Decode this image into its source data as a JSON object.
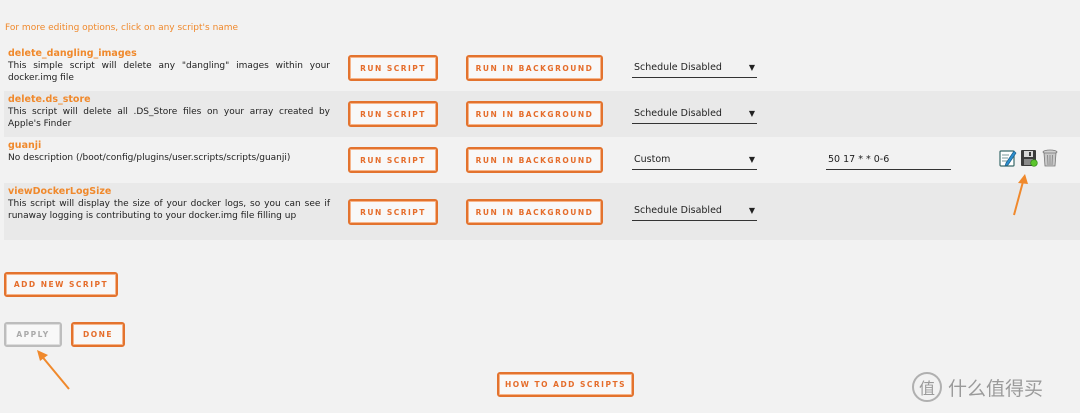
{
  "hint": "For more editing options, click on any script's name",
  "scripts": [
    {
      "name": "delete_dangling_images",
      "description": "This simple script will delete any \"dangling\" images within your docker.img file",
      "run": "RUN SCRIPT",
      "background": "RUN IN BACKGROUND",
      "schedule": "Schedule Disabled"
    },
    {
      "name": "delete.ds_store",
      "description": "This script will delete all .DS_Store files on your array created by Apple's Finder",
      "run": "RUN SCRIPT",
      "background": "RUN IN BACKGROUND",
      "schedule": "Schedule Disabled"
    },
    {
      "name": "guanji",
      "description": "No description (/boot/config/plugins/user.scripts/scripts/guanji)",
      "run": "RUN SCRIPT",
      "background": "RUN IN BACKGROUND",
      "schedule": "Custom",
      "cron": "50 17 * * 0-6"
    },
    {
      "name": "viewDockerLogSize",
      "description": "This script will display the size of your docker logs, so you can see if runaway logging is contributing to your docker.img file filling up",
      "run": "RUN SCRIPT",
      "background": "RUN IN BACKGROUND",
      "schedule": "Schedule Disabled"
    }
  ],
  "buttons": {
    "add_new": "ADD NEW SCRIPT",
    "apply": "APPLY",
    "done": "DONE",
    "how_to": "HOW TO ADD SCRIPTS"
  },
  "icons": [
    "edit-icon",
    "save-icon",
    "trash-icon"
  ],
  "watermark": {
    "logo": "值",
    "text": "什么值得买"
  },
  "colors": {
    "accent": "#e3732e",
    "name": "#f0892c",
    "arrow": "#f0892c"
  }
}
